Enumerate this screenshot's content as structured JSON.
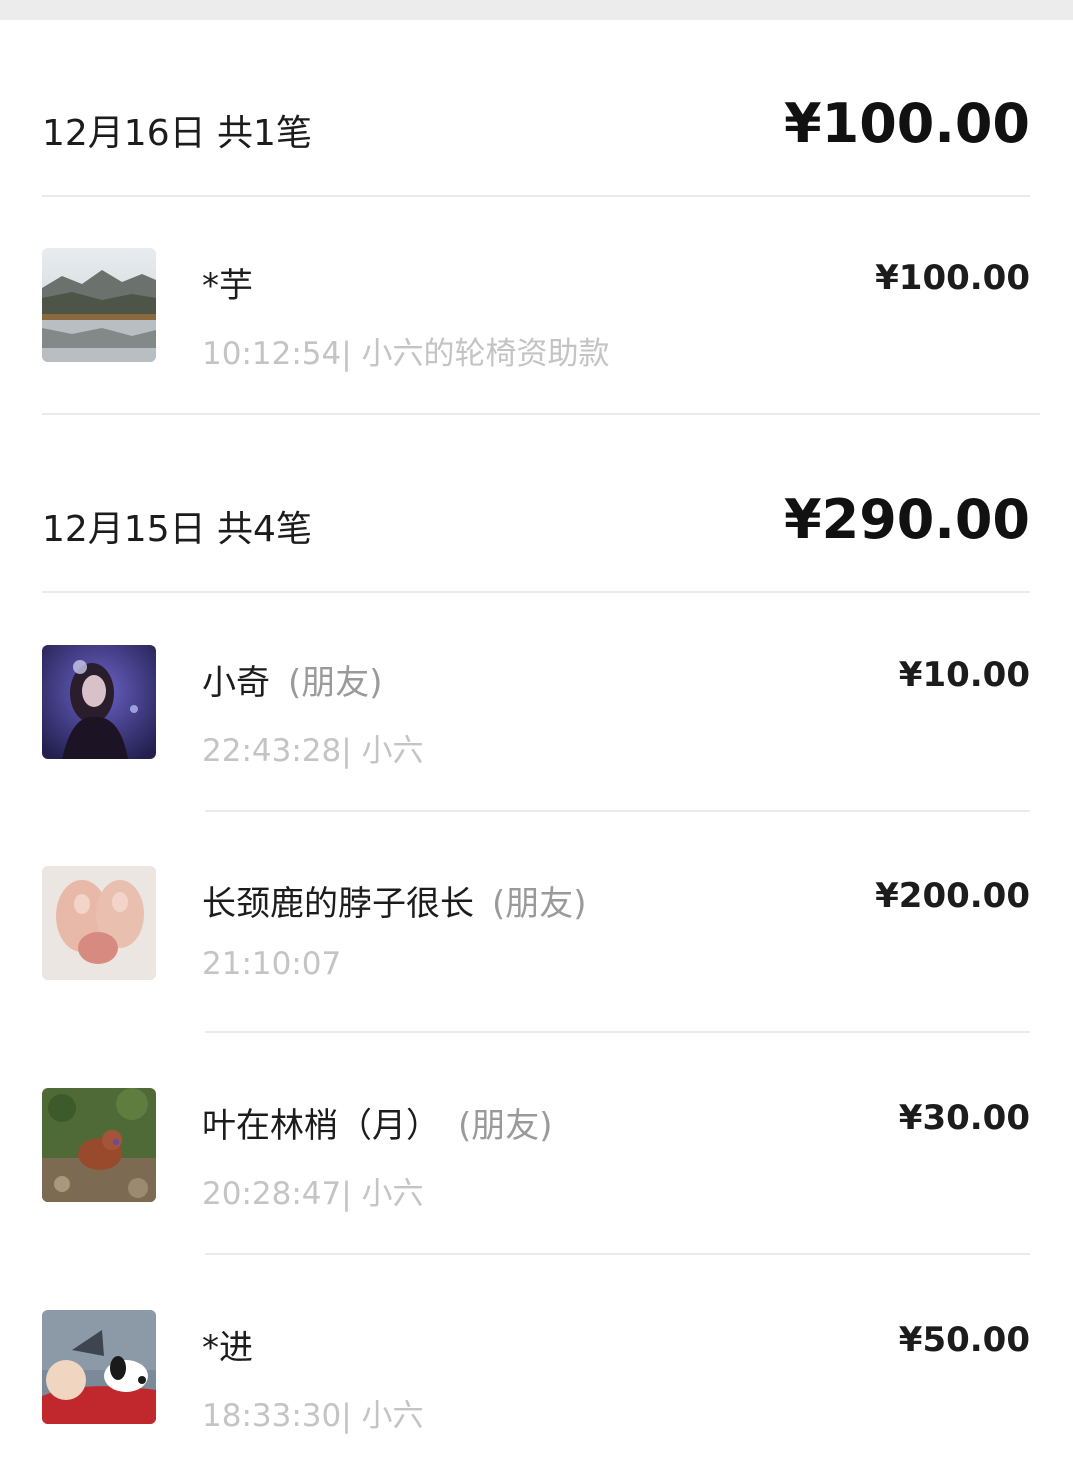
{
  "days": [
    {
      "label": "12月16日 共1笔",
      "total": "¥100.00",
      "records": [
        {
          "name": "*芋",
          "tag": "",
          "amount": "¥100.00",
          "meta": "10:12:54| 小六的轮椅资助款",
          "avatar": "landscape-lake-photo"
        }
      ]
    },
    {
      "label": "12月15日 共4笔",
      "total": "¥290.00",
      "records": [
        {
          "name": "小奇",
          "tag": "(朋友)",
          "amount": "¥10.00",
          "meta": "22:43:28| 小六",
          "avatar": "girl-portrait-photo"
        },
        {
          "name": "长颈鹿的脖子很长",
          "tag": "(朋友)",
          "amount": "¥200.00",
          "meta": "21:10:07",
          "avatar": "cat-paw-photo"
        },
        {
          "name": "叶在林梢（月）",
          "tag": "(朋友)",
          "amount": "¥30.00",
          "meta": "20:28:47| 小六",
          "avatar": "dog-on-grass-photo"
        },
        {
          "name": "*进",
          "tag": "",
          "amount": "¥50.00",
          "meta": "18:33:30| 小六",
          "avatar": "snoopy-cartoon"
        }
      ]
    }
  ]
}
